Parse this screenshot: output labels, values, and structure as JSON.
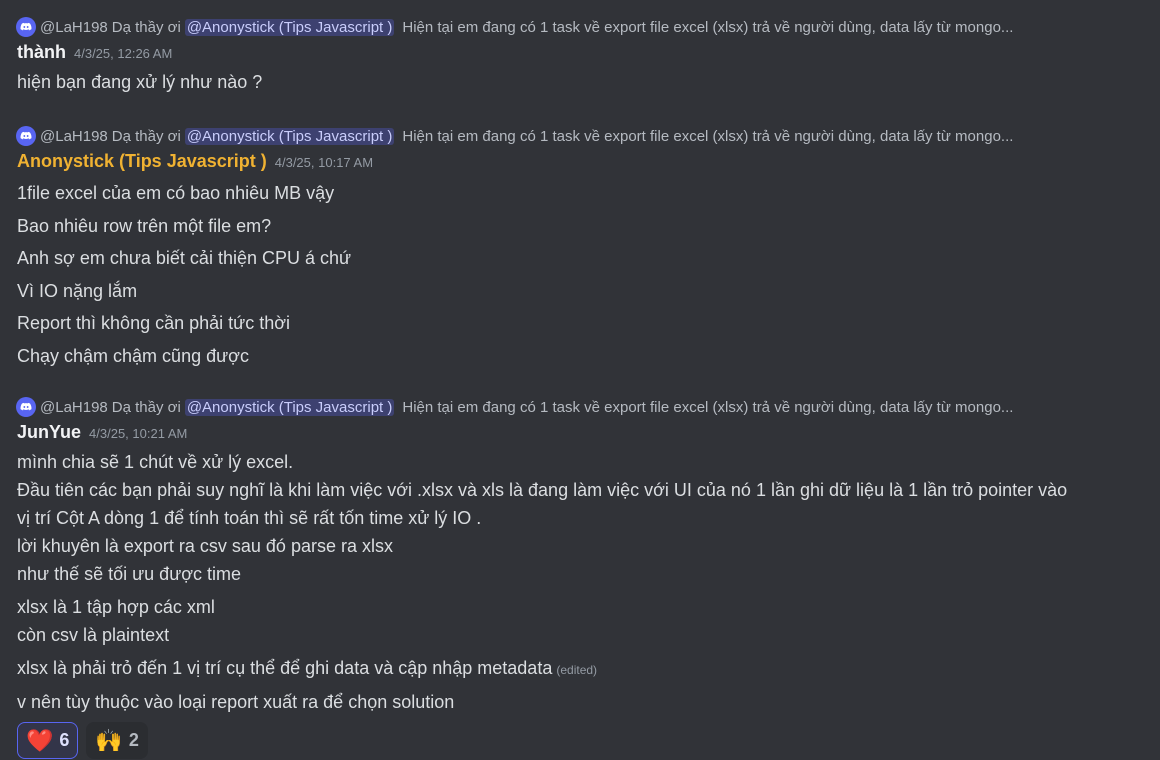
{
  "colors": {
    "background": "#313338",
    "mention_bg": "#5865f2",
    "author_gold": "#f0b232",
    "reaction_active_border": "#5865f2"
  },
  "messages": [
    {
      "reply": {
        "user": "@LaH198",
        "pre": "Dạ thầy ơi",
        "mention": "@Anonystick (Tips Javascript )",
        "snippet": "Hiện tại em đang có 1 task về export file excel (xlsx) trả về người dùng, data lấy từ mongo..."
      },
      "author": "thành",
      "timestamp": "4/3/25, 12:26 AM",
      "lines": [
        "hiện bạn đang xử lý như nào ?"
      ]
    },
    {
      "reply": {
        "user": "@LaH198",
        "pre": "Dạ thầy ơi",
        "mention": "@Anonystick (Tips Javascript )",
        "snippet": "Hiện tại em đang có 1 task về export file excel (xlsx) trả về người dùng, data lấy từ mongo..."
      },
      "author": "Anonystick (Tips Javascript )",
      "timestamp": "4/3/25, 10:17 AM",
      "lines": [
        "1file excel của em có bao nhiêu MB vậy",
        "Bao nhiêu row trên một file em?",
        "Anh sợ em chưa biết cải thiện CPU á chứ",
        "Vì IO nặng lắm",
        "Report thì không cần phải tức thời",
        "Chạy chậm chậm cũng được"
      ]
    },
    {
      "reply": {
        "user": "@LaH198",
        "pre": "Dạ thầy ơi",
        "mention": "@Anonystick (Tips Javascript )",
        "snippet": "Hiện tại em đang có 1 task về export file excel (xlsx) trả về người dùng, data lấy từ mongo..."
      },
      "author": "JunYue",
      "timestamp": "4/3/25, 10:21 AM",
      "lines": [
        "mình chia sẽ 1 chút về xử lý excel.",
        "Đầu tiên các bạn phải suy nghĩ là khi làm việc với .xlsx và xls là đang làm việc với UI của nó 1 lần ghi dữ liệu là 1 lần trỏ pointer vào",
        "vị trí Cột A dòng 1 để tính toán thì sẽ rất tốn time xử lý IO .",
        "lời khuyên là export ra csv sau đó parse ra xlsx",
        "như thế sẽ tối ưu được time",
        "xlsx là 1 tập hợp các xml",
        "còn csv là plaintext",
        "xlsx là phải trỏ đến 1 vị trí cụ thể để ghi data và cập nhập metadata",
        "v nên tùy thuộc vào loại report xuất ra để chọn solution"
      ],
      "edited_label": "(edited)",
      "reactions": [
        {
          "emoji": "❤️",
          "icon": "heart-icon",
          "count": "6"
        },
        {
          "emoji": "🙌",
          "icon": "raised-hands-icon",
          "count": "2"
        }
      ]
    }
  ]
}
